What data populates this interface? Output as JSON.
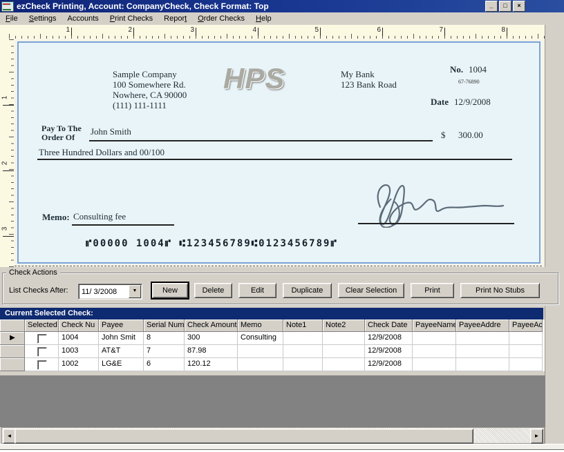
{
  "window": {
    "title": "ezCheck Printing, Account: CompanyCheck, Check Format: Top",
    "controls": {
      "minimize": "_",
      "restore": "□",
      "close": "×"
    }
  },
  "menu": {
    "items": [
      {
        "label": "File",
        "underline": 0
      },
      {
        "label": "Settings",
        "underline": 0
      },
      {
        "label": "Accounts",
        "underline": -1
      },
      {
        "label": "Print Checks",
        "underline": 0
      },
      {
        "label": "Report",
        "underline": 5
      },
      {
        "label": "Order Checks",
        "underline": 0
      },
      {
        "label": "Help",
        "underline": 0
      }
    ]
  },
  "ruler": {
    "horizontal_numbers": [
      "1",
      "2",
      "3",
      "4",
      "5",
      "6",
      "7",
      "8"
    ],
    "vertical_numbers": [
      "1",
      "2",
      "3"
    ]
  },
  "check_preview": {
    "company": [
      "Sample Company",
      "100 Somewhere Rd.",
      "Nowhere, CA 90000",
      "(111) 111-1111"
    ],
    "logo": "HPS",
    "bank": [
      "My Bank",
      "123 Bank Road"
    ],
    "number_label": "No.",
    "number": "1004",
    "fraction": "67-76890",
    "date_label": "Date",
    "date": "12/9/2008",
    "payto_line1": "Pay To The",
    "payto_line2": "Order Of",
    "payee": "John Smith",
    "dollar": "$",
    "amount": "300.00",
    "amount_words": "Three Hundred  Dollars and 00/100",
    "memo_label": "Memo:",
    "memo": "Consulting fee",
    "micr": "⑈00000 1004⑈ ⑆123456789⑆0123456789⑈"
  },
  "actions": {
    "group_title": "Check Actions",
    "list_label": "List Checks After:",
    "date_filter": "11/ 3/2008",
    "buttons": [
      "New",
      "Delete",
      "Edit",
      "Duplicate",
      "Clear Selection",
      "Print",
      "Print No Stubs"
    ]
  },
  "grid": {
    "banner": "Current Selected Check:",
    "columns": [
      "Selected",
      "Check Nu",
      "Payee",
      "Serial Num",
      "Check Amount",
      "Memo",
      "Note1",
      "Note2",
      "Check Date",
      "PayeeName",
      "PayeeAddre",
      "PayeeAc"
    ],
    "rows": [
      {
        "current": true,
        "selected": false,
        "cells": [
          "1004",
          "John Smit",
          "8",
          "300",
          "Consulting",
          "",
          "",
          "12/9/2008",
          "",
          "",
          ""
        ]
      },
      {
        "current": false,
        "selected": false,
        "cells": [
          "1003",
          "AT&T",
          "7",
          "87.98",
          "",
          "",
          "",
          "12/9/2008",
          "",
          "",
          ""
        ]
      },
      {
        "current": false,
        "selected": false,
        "cells": [
          "1002",
          "LG&E",
          "6",
          "120.12",
          "",
          "",
          "",
          "12/9/2008",
          "",
          "",
          ""
        ]
      }
    ]
  },
  "colors": {
    "titlebar": "#0f2478",
    "banner": "#0e2a70",
    "check_background": "#e9f4f8",
    "check_border": "#7aa4d6",
    "ruler_background": "#fcf9e3",
    "chrome": "#d4d0c8",
    "empty_area": "#828282"
  }
}
